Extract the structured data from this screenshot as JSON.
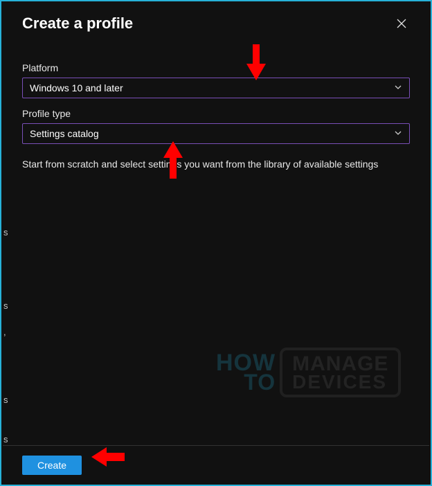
{
  "header": {
    "title": "Create a profile"
  },
  "fields": {
    "platform": {
      "label": "Platform",
      "value": "Windows 10 and later"
    },
    "profile_type": {
      "label": "Profile type",
      "value": "Settings catalog"
    }
  },
  "description": "Start from scratch and select settings you want from the library of available settings",
  "footer": {
    "create_label": "Create"
  },
  "watermark": {
    "how": "HOW",
    "to": "TO",
    "manage": "MANAGE",
    "devices": "DEVICES"
  }
}
